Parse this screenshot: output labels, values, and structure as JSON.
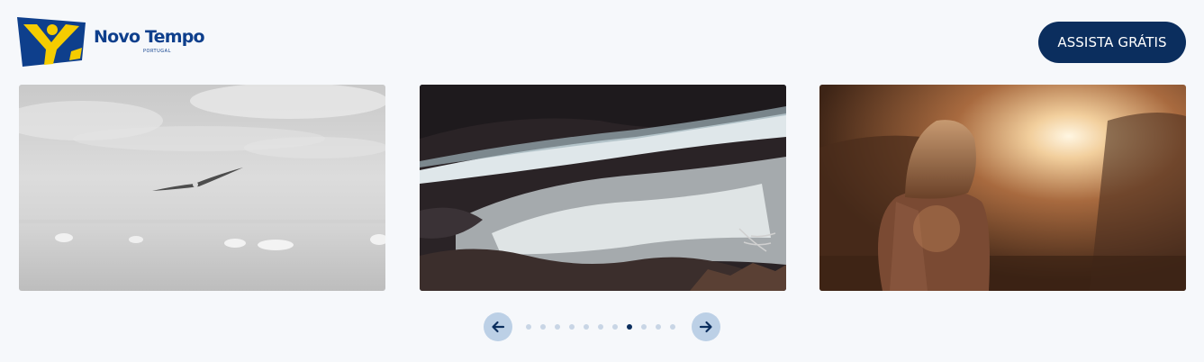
{
  "header": {
    "logo_name": "Novo Tempo",
    "logo_sub": "PORTUGAL",
    "cta_label": "ASSISTA GRÁTIS"
  },
  "carousel": {
    "slides": [
      {
        "image": "black-and-white seagull over sea"
      },
      {
        "image": "crashing ocean waves on dark rocks"
      },
      {
        "image": "woman facing sunset"
      }
    ],
    "dot_count": 11,
    "active_index": 7,
    "prev_icon": "arrow-left-icon",
    "next_icon": "arrow-right-icon"
  },
  "colors": {
    "background": "#f6f8fb",
    "brand_navy": "#0b2e5e",
    "logo_blue": "#0e3f8c",
    "logo_yellow": "#f5cc00",
    "nav_button": "#bcd0e6",
    "dot_inactive": "#c8d5e5"
  }
}
